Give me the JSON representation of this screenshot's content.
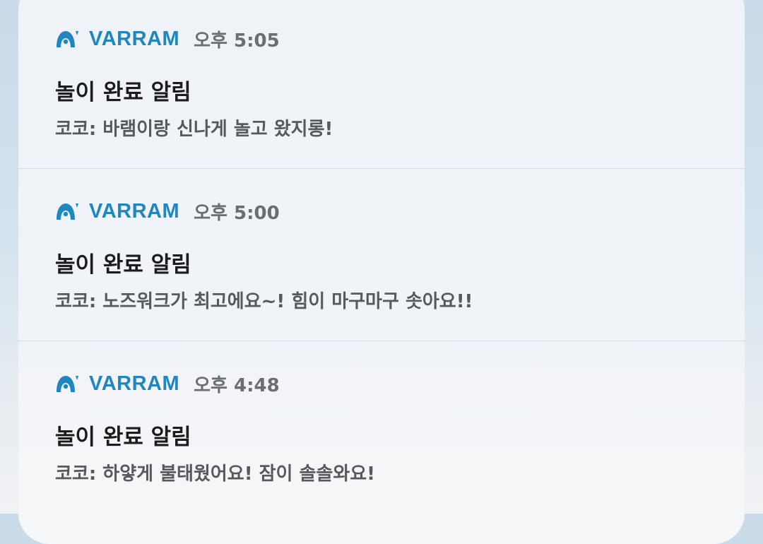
{
  "notifications": [
    {
      "app_name": "VARRAM",
      "time": "오후 5:05",
      "title": "놀이 완료 알림",
      "message": "코코: 바램이랑 신나게 놀고 왔지롱!"
    },
    {
      "app_name": "VARRAM",
      "time": "오후 5:00",
      "title": "놀이 완료 알림",
      "message": "코코: 노즈워크가 최고에요~! 힘이 마구마구 솟아요!!"
    },
    {
      "app_name": "VARRAM",
      "time": "오후 4:48",
      "title": "놀이 완료 알림",
      "message": "코코: 하얗게 불태웠어요! 잠이 솔솔와요!"
    }
  ],
  "icon": "varram-app-icon",
  "colors": {
    "brand": "#1e87c0",
    "title": "#1c1c1e",
    "body": "#56595d",
    "time": "#6a6e73"
  }
}
